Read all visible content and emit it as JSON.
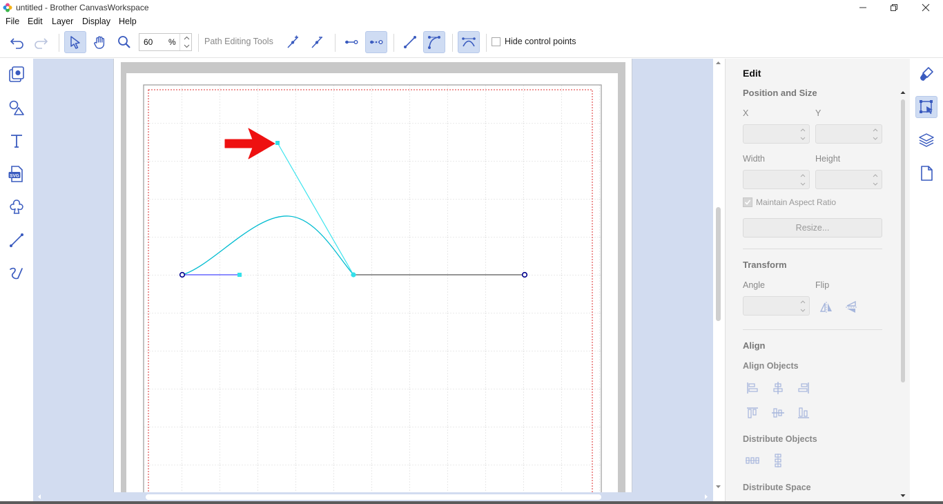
{
  "window": {
    "title": "untitled - Brother CanvasWorkspace"
  },
  "menu": [
    "File",
    "Edit",
    "Layer",
    "Display",
    "Help"
  ],
  "toolbar": {
    "zoom_value": "60",
    "zoom_unit": "%",
    "path_tools_label": "Path Editing Tools",
    "hide_control_points_label": "Hide control points",
    "hide_control_points_checked": false
  },
  "edit_panel": {
    "title": "Edit",
    "position_size": "Position and Size",
    "x_label": "X",
    "y_label": "Y",
    "width_label": "Width",
    "height_label": "Height",
    "maintain_aspect": "Maintain Aspect Ratio",
    "resize_button": "Resize...",
    "transform": "Transform",
    "angle_label": "Angle",
    "flip_label": "Flip",
    "align": "Align",
    "align_objects": "Align Objects",
    "distribute_objects": "Distribute Objects",
    "distribute_space": "Distribute Space"
  },
  "colors": {
    "accent": "#3a5bbf",
    "canvas_bg": "#d2dcf0",
    "path_cyan": "#00c8d8",
    "handle_cyan": "#35e0ea",
    "arrow_red": "#ee1111",
    "anchor_blue": "#00008b"
  }
}
